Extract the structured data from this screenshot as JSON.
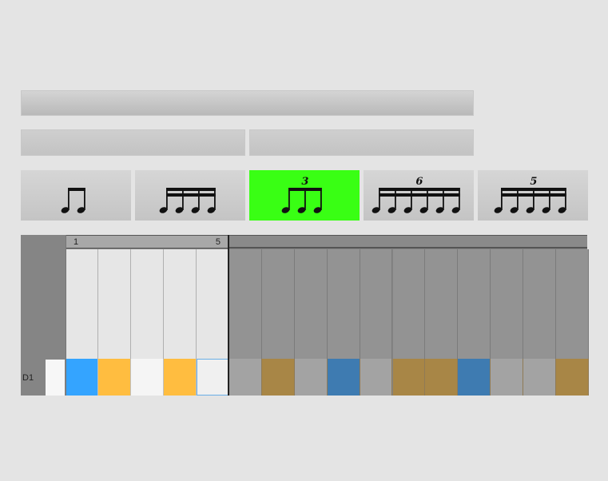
{
  "rhythm_buttons": [
    {
      "name": "eighth-notes",
      "tuplet": "",
      "notes": 2,
      "beams": 1,
      "active": false
    },
    {
      "name": "sixteenth-notes",
      "tuplet": "",
      "notes": 4,
      "beams": 2,
      "active": false
    },
    {
      "name": "triplet-eighths",
      "tuplet": "3",
      "notes": 3,
      "beams": 1,
      "active": true
    },
    {
      "name": "sextuplet-sixteenths",
      "tuplet": "6",
      "notes": 6,
      "beams": 2,
      "active": false
    },
    {
      "name": "quintuplet-sixteenths",
      "tuplet": "5",
      "notes": 5,
      "beams": 2,
      "active": false
    }
  ],
  "loop": {
    "start_label": "1",
    "end_label": "5"
  },
  "row": {
    "label": "D1"
  },
  "steps": [
    {
      "color": "#34a4ff",
      "in_loop": true
    },
    {
      "color": "#ffbd40",
      "in_loop": true
    },
    {
      "color": "#f5f5f5",
      "in_loop": true
    },
    {
      "color": "#ffbd40",
      "in_loop": true
    },
    {
      "color": "#f0f0f0",
      "in_loop": true
    },
    {
      "color": "#a3a3a3",
      "in_loop": false
    },
    {
      "color": "#a88646",
      "in_loop": false
    },
    {
      "color": "#a3a3a3",
      "in_loop": false
    },
    {
      "color": "#3e7bb1",
      "in_loop": false
    },
    {
      "color": "#a3a3a3",
      "in_loop": false
    },
    {
      "color": "#a88646",
      "in_loop": false
    },
    {
      "color": "#a88646",
      "in_loop": false
    },
    {
      "color": "#3e7bb1",
      "in_loop": false
    },
    {
      "color": "#a3a3a3",
      "in_loop": false
    },
    {
      "color": "#a3a3a3",
      "in_loop": false
    },
    {
      "color": "#a88646",
      "in_loop": false
    }
  ]
}
